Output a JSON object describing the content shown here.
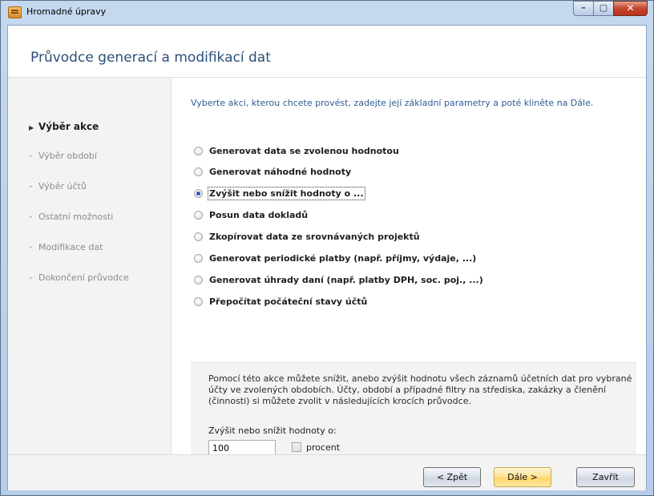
{
  "window": {
    "title": "Hromadné úpravy",
    "controls": {
      "minimize": "–",
      "maximize": "▢",
      "close": "✕"
    }
  },
  "header": {
    "title": "Průvodce generací a modifikací dat"
  },
  "sidebar": {
    "steps": [
      {
        "label": "Výběr akce",
        "active": true
      },
      {
        "label": "Výběr období",
        "active": false
      },
      {
        "label": "Výběr účtů",
        "active": false
      },
      {
        "label": "Ostatní možnosti",
        "active": false
      },
      {
        "label": "Modifikace dat",
        "active": false
      },
      {
        "label": "Dokončení průvodce",
        "active": false
      }
    ]
  },
  "main": {
    "instruction": "Vyberte akci, kterou chcete provést, zadejte její základní parametry a poté klinête na Dále.",
    "options": [
      {
        "label": "Generovat data se zvolenou hodnotou",
        "checked": false
      },
      {
        "label": "Generovat náhodné hodnoty",
        "checked": false
      },
      {
        "label": "Zvýšit nebo snížit hodnoty o ...",
        "checked": true
      },
      {
        "label": "Posun data dokladů",
        "checked": false
      },
      {
        "label": "Zkopírovat data ze srovnávaných projektů",
        "checked": false
      },
      {
        "label": "Generovat periodické platby (např. příjmy, výdaje, ...)",
        "checked": false
      },
      {
        "label": "Generovat úhrady daní (např. platby DPH, soc. poj., ...)",
        "checked": false
      },
      {
        "label": "Přepočítat počáteční stavy účtů",
        "checked": false
      }
    ],
    "description": "Pomocí této akce můžete snížit, anebo zvýšit hodnotu všech záznamů účetních dat pro vybrané účty ve zvolených obdobích. Účty, období a případné filtry na střediska, zakázky a členění (činnosti) si můžete zvolit v následujících krocích průvodce.",
    "amount_label": "Zvýšit nebo snížit hodnoty o:",
    "amount_value": "100",
    "percent_label": "procent",
    "percent_checked": false
  },
  "footer": {
    "back_label": "< Zpět",
    "next_label": "Dále >",
    "close_label": "Zavřít"
  }
}
